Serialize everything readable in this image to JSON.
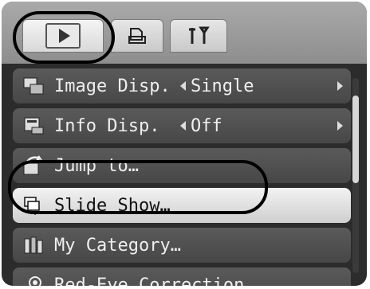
{
  "tabs": [
    {
      "name": "playback",
      "icon": "playback-icon",
      "active": true
    },
    {
      "name": "print",
      "icon": "print-icon",
      "active": false
    },
    {
      "name": "setup",
      "icon": "setup-tools-icon",
      "active": false
    }
  ],
  "menu": {
    "items": [
      {
        "label": "Image Disp.",
        "value": "Single",
        "icon": "image-display-icon"
      },
      {
        "label": "Info Disp.",
        "value": "Off",
        "icon": "info-display-icon"
      },
      {
        "label": "Jump to…",
        "icon": "jump-to-icon"
      },
      {
        "label": "Slide Show…",
        "icon": "slide-show-icon",
        "selected": true
      },
      {
        "label": "My Category…",
        "icon": "my-category-icon"
      },
      {
        "label": "Red-Eye Correction…",
        "icon": "red-eye-correction-icon"
      }
    ]
  },
  "colors": {
    "menu_bg": "#2c2c2c",
    "row_bg": "#4f4f4f",
    "selected_bg": "#e6e6e6",
    "highlight_ring": "#000000"
  }
}
